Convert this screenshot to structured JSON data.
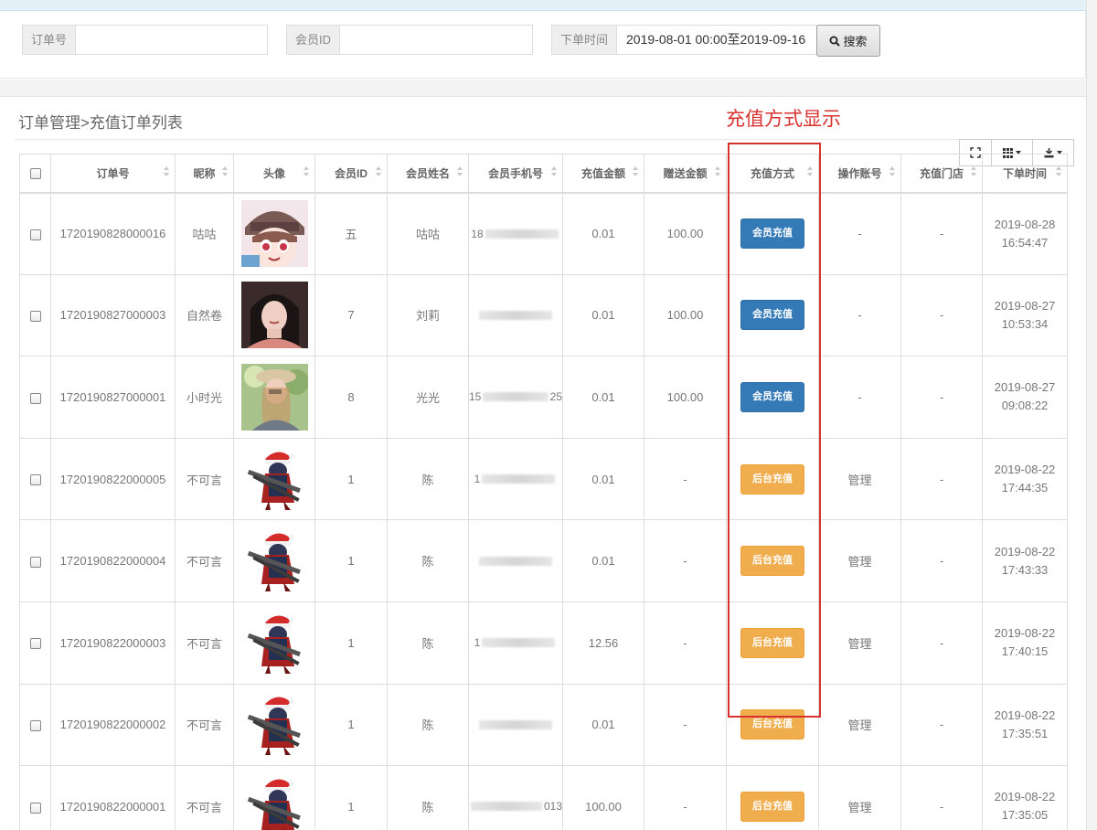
{
  "search": {
    "order_no_label": "订单号",
    "order_no_value": "",
    "member_id_label": "会员ID",
    "member_id_value": "",
    "time_label": "下单时间",
    "time_value": "2019-08-01 00:00至2019-09-16",
    "search_button": "搜索"
  },
  "breadcrumb": "订单管理>充值订单列表",
  "annotation": "充值方式显示",
  "colors": {
    "blue_badge": "#337ab7",
    "orange_badge": "#f0ad4e",
    "annotation_red": "#d9312f"
  },
  "toolbar": {
    "icons": [
      "fullscreen-icon",
      "columns-icon",
      "export-icon"
    ]
  },
  "columns": [
    "订单号",
    "昵称",
    "头像",
    "会员ID",
    "会员姓名",
    "会员手机号",
    "充值金额",
    "赠送金额",
    "充值方式",
    "操作账号",
    "充值门店",
    "下单时间"
  ],
  "rows": [
    {
      "order_no": "1720190828000016",
      "nickname": "咕咕",
      "avatar": "anime-girl-avatar",
      "member_id": "五",
      "name": "咕咕",
      "phone_prefix": "18",
      "phone_suffix": "",
      "amount": "0.01",
      "bonus": "100.00",
      "method": "会员充值",
      "method_type": "blue",
      "operator": "-",
      "store": "-",
      "date": "2019-08-28",
      "time": "16:54:47"
    },
    {
      "order_no": "1720190827000003",
      "nickname": "自然卷",
      "avatar": "woman-photo-avatar",
      "member_id": "7",
      "name": "刘莉",
      "phone_prefix": "",
      "phone_suffix": "",
      "amount": "0.01",
      "bonus": "100.00",
      "method": "会员充值",
      "method_type": "blue",
      "operator": "-",
      "store": "-",
      "date": "2019-08-27",
      "time": "10:53:34"
    },
    {
      "order_no": "1720190827000001",
      "nickname": "小时光",
      "avatar": "girl-hat-photo-avatar",
      "member_id": "8",
      "name": "光光",
      "phone_prefix": "15",
      "phone_suffix": "25",
      "amount": "0.01",
      "bonus": "100.00",
      "method": "会员充值",
      "method_type": "blue",
      "operator": "-",
      "store": "-",
      "date": "2019-08-27",
      "time": "09:08:22"
    },
    {
      "order_no": "1720190822000005",
      "nickname": "不可言",
      "avatar": "santa-gunner-avatar",
      "member_id": "1",
      "name": "陈",
      "phone_prefix": "1",
      "phone_suffix": "",
      "amount": "0.01",
      "bonus": "-",
      "method": "后台充值",
      "method_type": "orange",
      "operator": "管理",
      "store": "-",
      "date": "2019-08-22",
      "time": "17:44:35"
    },
    {
      "order_no": "1720190822000004",
      "nickname": "不可言",
      "avatar": "santa-gunner-avatar",
      "member_id": "1",
      "name": "陈",
      "phone_prefix": "",
      "phone_suffix": "",
      "amount": "0.01",
      "bonus": "-",
      "method": "后台充值",
      "method_type": "orange",
      "operator": "管理",
      "store": "-",
      "date": "2019-08-22",
      "time": "17:43:33"
    },
    {
      "order_no": "1720190822000003",
      "nickname": "不可言",
      "avatar": "santa-gunner-avatar",
      "member_id": "1",
      "name": "陈",
      "phone_prefix": "1",
      "phone_suffix": "",
      "amount": "12.56",
      "bonus": "-",
      "method": "后台充值",
      "method_type": "orange",
      "operator": "管理",
      "store": "-",
      "date": "2019-08-22",
      "time": "17:40:15"
    },
    {
      "order_no": "1720190822000002",
      "nickname": "不可言",
      "avatar": "santa-gunner-avatar",
      "member_id": "1",
      "name": "陈",
      "phone_prefix": "",
      "phone_suffix": "",
      "amount": "0.01",
      "bonus": "-",
      "method": "后台充值",
      "method_type": "orange",
      "operator": "管理",
      "store": "-",
      "date": "2019-08-22",
      "time": "17:35:51"
    },
    {
      "order_no": "1720190822000001",
      "nickname": "不可言",
      "avatar": "santa-gunner-avatar",
      "member_id": "1",
      "name": "陈",
      "phone_prefix": "",
      "phone_suffix": "013",
      "amount": "100.00",
      "bonus": "-",
      "method": "后台充值",
      "method_type": "orange",
      "operator": "管理",
      "store": "-",
      "date": "2019-08-22",
      "time": "17:35:05"
    }
  ]
}
